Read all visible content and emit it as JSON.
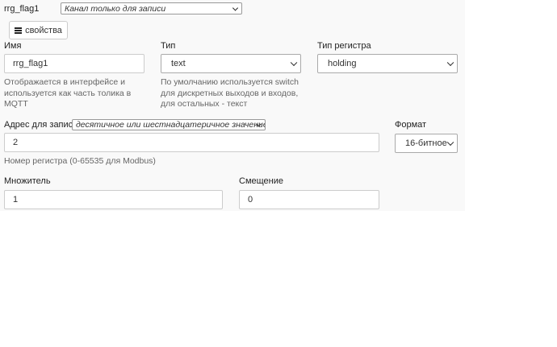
{
  "header": {
    "channel_name": "rrg_flag1",
    "channel_mode": "Канал только для записи"
  },
  "properties_button": {
    "label": "свойства",
    "icon": "list-icon"
  },
  "name_field": {
    "label": "Имя",
    "value": "rrg_flag1",
    "help": "Отображается в интерфейсе и используется как часть толика в MQTT"
  },
  "type_field": {
    "label": "Тип",
    "value": "text",
    "help": "По умолчанию используется switch для дискретных выходов и входов, для остальных - текст"
  },
  "register_type_field": {
    "label": "Тип регистра",
    "value": "holding"
  },
  "write_address_field": {
    "label": "Адрес для записи",
    "mode": "десятичное или шестнадцатеричное значение",
    "value": "2",
    "help": "Номер регистра (0-65535 для Modbus)"
  },
  "format_field": {
    "label": "Формат",
    "value": "16-битное"
  },
  "multiplier_field": {
    "label": "Множитель",
    "value": "1"
  },
  "offset_field": {
    "label": "Смещение",
    "value": "0"
  }
}
